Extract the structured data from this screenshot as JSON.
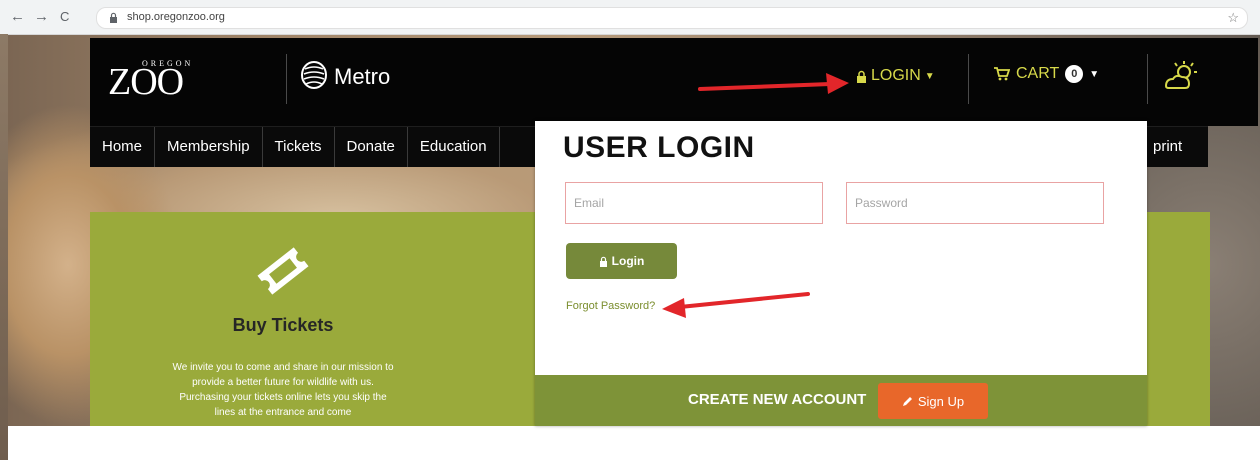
{
  "browser": {
    "back_icon": "←",
    "forward_icon": "→",
    "reload_icon": "C",
    "lock_icon": "🔒",
    "url": "shop.oregonzoo.org",
    "bookmark_icon": "☆"
  },
  "header": {
    "logo_top": "OREGON",
    "logo_word": "ZOO",
    "metro_label": "Metro",
    "login_label": "LOGIN",
    "cart_label": "CART",
    "cart_count": "0",
    "accent_color": "#d7d94a"
  },
  "nav": {
    "items": [
      "Home",
      "Membership",
      "Tickets",
      "Donate",
      "Education"
    ],
    "partial_item": "print"
  },
  "tickets_panel": {
    "title": "Buy Tickets",
    "body": "We invite you to come and share in our mission to provide a better future for wildlife with us. Purchasing your tickets online lets you skip the lines at the entrance and come",
    "color": "#9aaa3b"
  },
  "login_modal": {
    "title": "USER LOGIN",
    "email_placeholder": "Email",
    "password_placeholder": "Password",
    "login_button": "Login",
    "forgot_password": "Forgot Password?",
    "create_account": "CREATE NEW ACCOUNT",
    "signup_button": "Sign Up",
    "footer_color": "#7e9338",
    "signup_color": "#e8672a"
  }
}
